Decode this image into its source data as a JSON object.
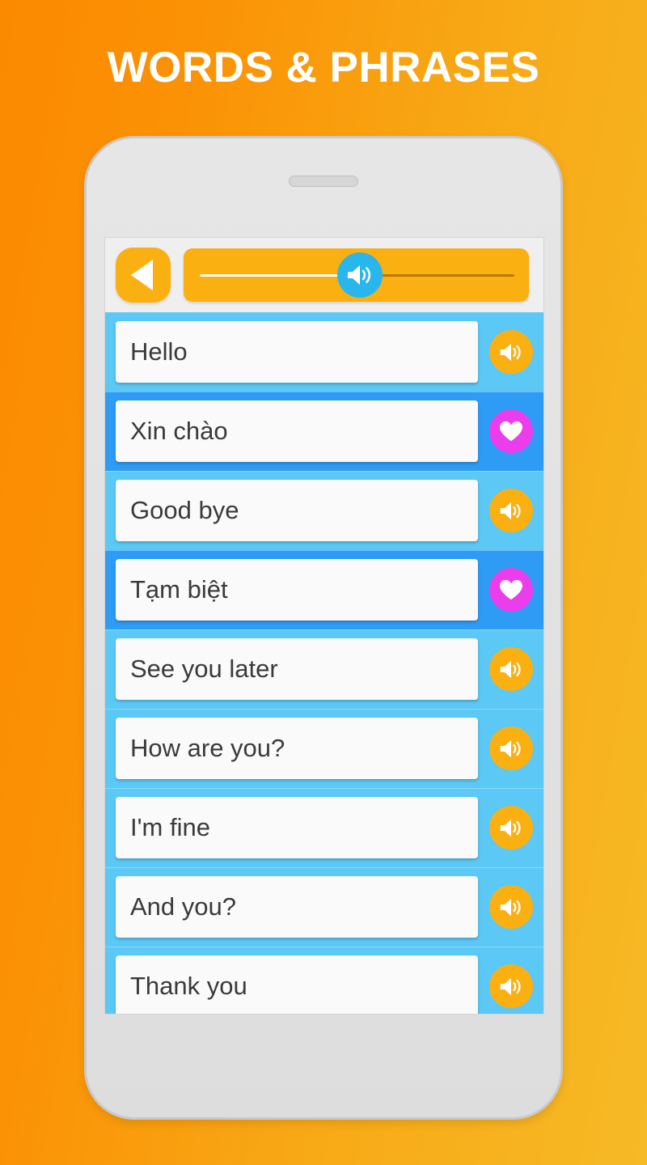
{
  "headline": "WORDS & PHRASES",
  "colors": {
    "bg_gradient_start": "#FB8A00",
    "bg_gradient_end": "#F6BA26",
    "phone_body": "#E3E3E3",
    "toolbar_bg": "#EFEFEF",
    "accent_orange": "#FBB012",
    "row_light_blue": "#5BC8F5",
    "row_dark_blue": "#2E9BF5",
    "heart_magenta": "#EC3DEC",
    "slider_thumb_blue": "#29B6EC",
    "card_bg": "#FAFAFA",
    "card_text": "#3A3A3A",
    "headline_text": "#FFFFFF"
  },
  "toolbar": {
    "back_label": "Back",
    "back_icon": "play-left-triangle-icon",
    "slider": {
      "icon": "speaker-volume-icon",
      "value_percent": 51,
      "min": 0,
      "max": 100
    }
  },
  "phone": {
    "earpiece_label": "Speaker grill"
  },
  "list": {
    "rows": [
      {
        "text": "Hello",
        "language": "en",
        "style": "light",
        "action_icon": "speaker-icon",
        "action": "play"
      },
      {
        "text": "Xin chào",
        "language": "vi",
        "style": "dark",
        "action_icon": "heart-icon",
        "action": "favorite"
      },
      {
        "text": "Good bye",
        "language": "en",
        "style": "light",
        "action_icon": "speaker-icon",
        "action": "play"
      },
      {
        "text": "Tạm biệt",
        "language": "vi",
        "style": "dark",
        "action_icon": "heart-icon",
        "action": "favorite"
      },
      {
        "text": "See you later",
        "language": "en",
        "style": "light",
        "action_icon": "speaker-icon",
        "action": "play"
      },
      {
        "text": "How are you?",
        "language": "en",
        "style": "light",
        "action_icon": "speaker-icon",
        "action": "play"
      },
      {
        "text": "I'm fine",
        "language": "en",
        "style": "light",
        "action_icon": "speaker-icon",
        "action": "play"
      },
      {
        "text": "And you?",
        "language": "en",
        "style": "light",
        "action_icon": "speaker-icon",
        "action": "play"
      },
      {
        "text": "Thank you",
        "language": "en",
        "style": "light",
        "action_icon": "speaker-icon",
        "action": "play"
      }
    ]
  }
}
